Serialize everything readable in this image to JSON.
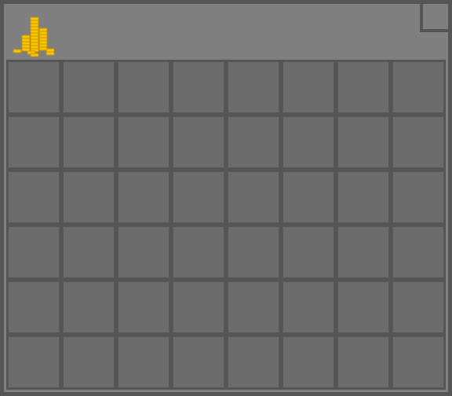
{
  "window": {
    "icon": "gold-coins-icon",
    "close_icon": "close-box"
  },
  "grid": {
    "rows": 6,
    "columns": 8,
    "slot_color": "#6b6b6b"
  },
  "colors": {
    "background": "#555555",
    "panel": "#7f7f7f",
    "coin_gold": "#f7c600",
    "coin_shade": "#d49a00"
  }
}
